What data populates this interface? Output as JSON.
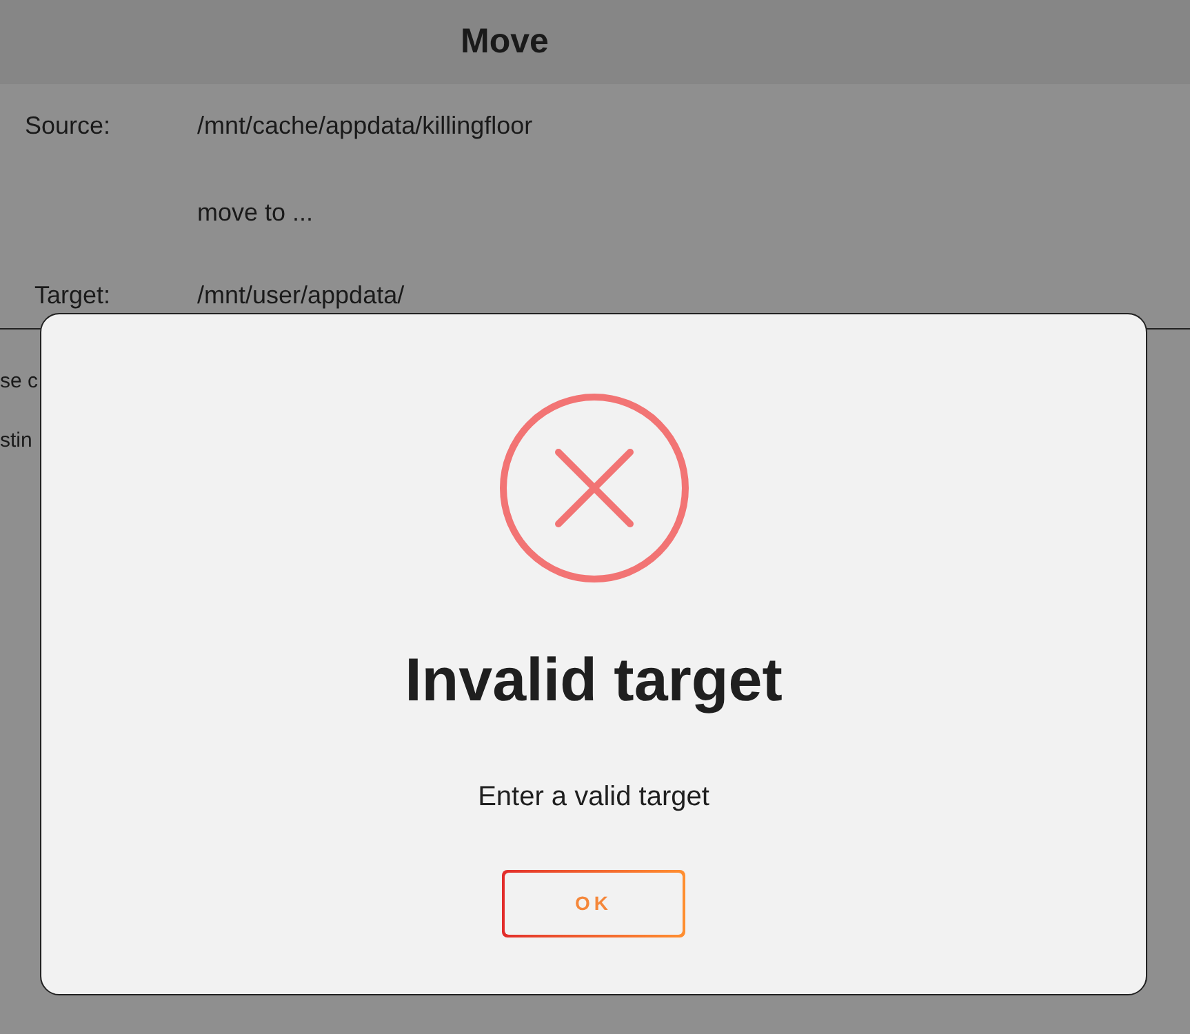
{
  "header": {
    "title": "Move"
  },
  "form": {
    "source": {
      "label": "Source:",
      "value": "/mnt/cache/appdata/killingfloor"
    },
    "hint": "move to ...",
    "target": {
      "label": "Target:",
      "value": "/mnt/user/appdata/"
    }
  },
  "hidden_lines": [
    "se c",
    "stin"
  ],
  "dialog": {
    "title": "Invalid target",
    "message": "Enter a valid target",
    "buttons": [
      {
        "label": "OK"
      }
    ]
  }
}
